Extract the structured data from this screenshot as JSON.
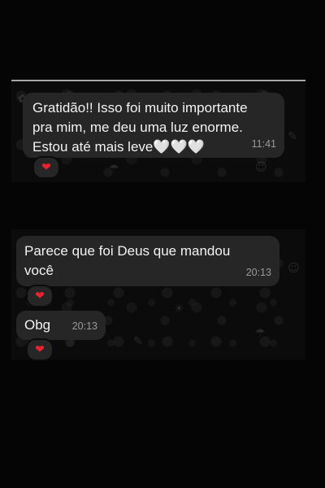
{
  "messages": [
    {
      "lines": [
        "Gratidão!! Isso foi muito importante",
        "pra mim, me deu uma luz enorme.",
        "Estou até mais leve🤍🤍🤍"
      ],
      "time": "11:41",
      "reaction": "❤"
    },
    {
      "lines": [
        "Parece que foi Deus que mandou",
        "você"
      ],
      "time": "20:13",
      "reaction": "❤"
    },
    {
      "lines": [
        "Obg"
      ],
      "time": "20:13",
      "reaction": "❤"
    }
  ],
  "colors": {
    "background": "#050505",
    "bubble": "#262626",
    "text": "#f2f2f2",
    "timestamp": "#9a9a9a",
    "heart": "#e8232f"
  }
}
